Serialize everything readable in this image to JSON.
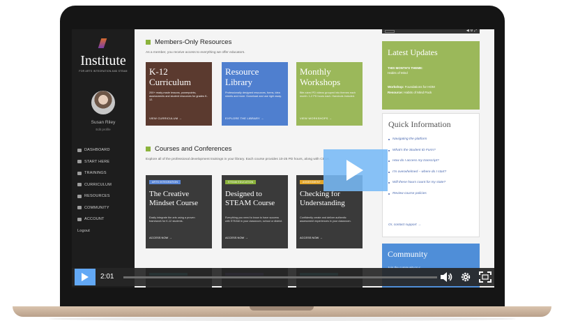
{
  "sidebar": {
    "logo": "Institute",
    "logo_subtitle": "FOR ARTS INTEGRATION AND STEAM",
    "user_name": "Susan Riley",
    "user_link": "Edit profile",
    "nav": [
      "DASHBOARD",
      "START HERE",
      "TRAININGS",
      "CURRICULUM",
      "RESOURCES",
      "COMMUNITY",
      "ACCOUNT",
      "Logout"
    ]
  },
  "resources": {
    "title": "Members-Only Resources",
    "description": "As a member, you receive access to everything we offer educators.",
    "cards": [
      {
        "title": "K-12 Curriculum",
        "desc": "200+ ready-made lessons, powerpoints, assessments and student resources for grades K-12.",
        "link": "VIEW CURRICULUM →"
      },
      {
        "title": "Resource Library",
        "desc": "Professionally designed resources, forms, idea sheets and more. Download and use right away.",
        "link": "EXPLORE THE LIBRARY →"
      },
      {
        "title": "Monthly Workshops",
        "desc": "Bite-sized PD videos grouped into themes each month. 1-2 PD hours each. Handouts included.",
        "link": "VIEW WORKSHOPS →"
      }
    ]
  },
  "courses": {
    "title": "Courses and Conferences",
    "description": "Explore all of the professional development trainings in your library. Each course provides 10-25 PD hours, along with CEUs.",
    "cards": [
      {
        "badge": "ARTS INTEGRATION",
        "title": "The Creative Mindset Course",
        "desc": "Easily integrate the arts using a proven framework for K-12 students.",
        "link": "ACCESS NOW →"
      },
      {
        "badge": "STEAM EDUCATION",
        "title": "Designed to STEAM Course",
        "desc": "Everything you need to know to have success with STEAM in your classroom, school or district.",
        "link": "ACCESS NOW →"
      },
      {
        "badge": "ASSESSMENT",
        "title": "Checking for Understanding",
        "desc": "Confidently create and deliver authentic assessment experiences in your classroom.",
        "link": "ACCESS NOW →"
      }
    ]
  },
  "updates": {
    "title": "Latest Updates",
    "theme_label": "THIS MONTH'S THEME:",
    "theme_value": "Habits of Mind",
    "workshop_label": "Workshop:",
    "workshop_value": "Foundations for HOM",
    "resource_label": "Resource:",
    "resource_value": "Habits of Mind Pack"
  },
  "quick_info": {
    "title": "Quick Information",
    "links": [
      "Navigating the platform",
      "What's the Student ID Form?",
      "How do I access my transcript?",
      "I'm overwhelmed – where do I start?",
      "Will these hours count for my state?",
      "Review course policies"
    ],
    "contact": "Or, contact support →"
  },
  "community": {
    "title": "Community",
    "desc": "Join the community to c"
  },
  "player": {
    "time": "2:01",
    "progress": 0
  },
  "colors": {
    "card_k12": "#5b3a2f",
    "card_library": "#4f7fcf",
    "card_workshops": "#9bb85a",
    "badge_arts": "#5b87d6",
    "badge_steam": "#8bb33c",
    "badge_assessment": "#e2a52a",
    "video_accent": "#62a8f5"
  },
  "icons": {
    "play": "play-icon",
    "volume": "volume-icon",
    "settings": "gear-icon",
    "fullscreen": "fullscreen-icon"
  }
}
